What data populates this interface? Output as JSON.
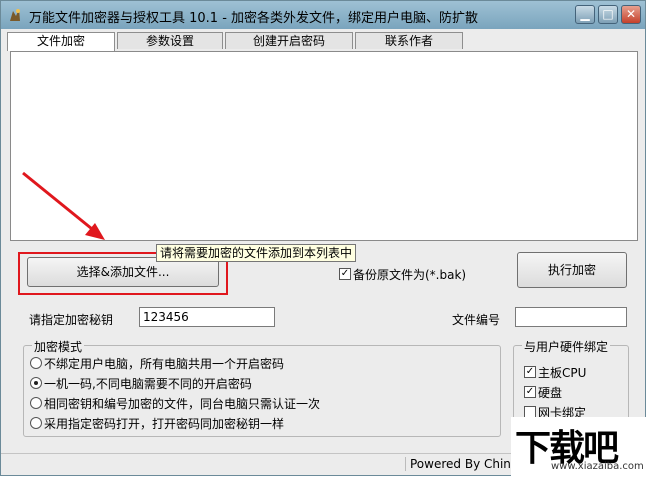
{
  "window": {
    "title": "万能文件加密器与授权工具 10.1 - 加密各类外发文件，绑定用户电脑、防扩散",
    "controls": {
      "minimize": "▁",
      "maximize": "□",
      "close": "✕"
    }
  },
  "tabs": [
    {
      "label": "文件加密",
      "active": true
    },
    {
      "label": "参数设置",
      "active": false
    },
    {
      "label": "创建开启密码",
      "active": false
    },
    {
      "label": "联系作者",
      "active": false
    }
  ],
  "actions": {
    "select_add_label": "选择&添加文件...",
    "execute_label": "执行加密",
    "tooltip": "请将需要加密的文件添加到本列表中"
  },
  "backup": {
    "label": "备份原文件为(*.bak)",
    "checked": true
  },
  "key": {
    "label": "请指定加密秘钥",
    "value": "123456"
  },
  "file_no": {
    "label": "文件编号",
    "value": ""
  },
  "mode": {
    "title": "加密模式",
    "options": [
      {
        "label": "不绑定用户电脑，所有电脑共用一个开启密码",
        "selected": false
      },
      {
        "label": "一机一码,不同电脑需要不同的开启密码",
        "selected": true
      },
      {
        "label": "相同密钥和编号加密的文件，同台电脑只需认证一次",
        "selected": false
      },
      {
        "label": "采用指定密码打开，打开密码同加密秘钥一样",
        "selected": false
      }
    ]
  },
  "hardware": {
    "title": "与用户硬件绑定",
    "options": [
      {
        "label": "主板CPU",
        "checked": true
      },
      {
        "label": "硬盘",
        "checked": true
      },
      {
        "label": "网卡绑定",
        "checked": false
      }
    ]
  },
  "status": {
    "text": "Powered By China"
  },
  "watermark": {
    "text": "下载吧",
    "url": "www.xiazaiba.com"
  },
  "colors": {
    "highlight": "#e0171d",
    "arrow": "#e0171d",
    "titlebar": "#8fb4c9"
  }
}
